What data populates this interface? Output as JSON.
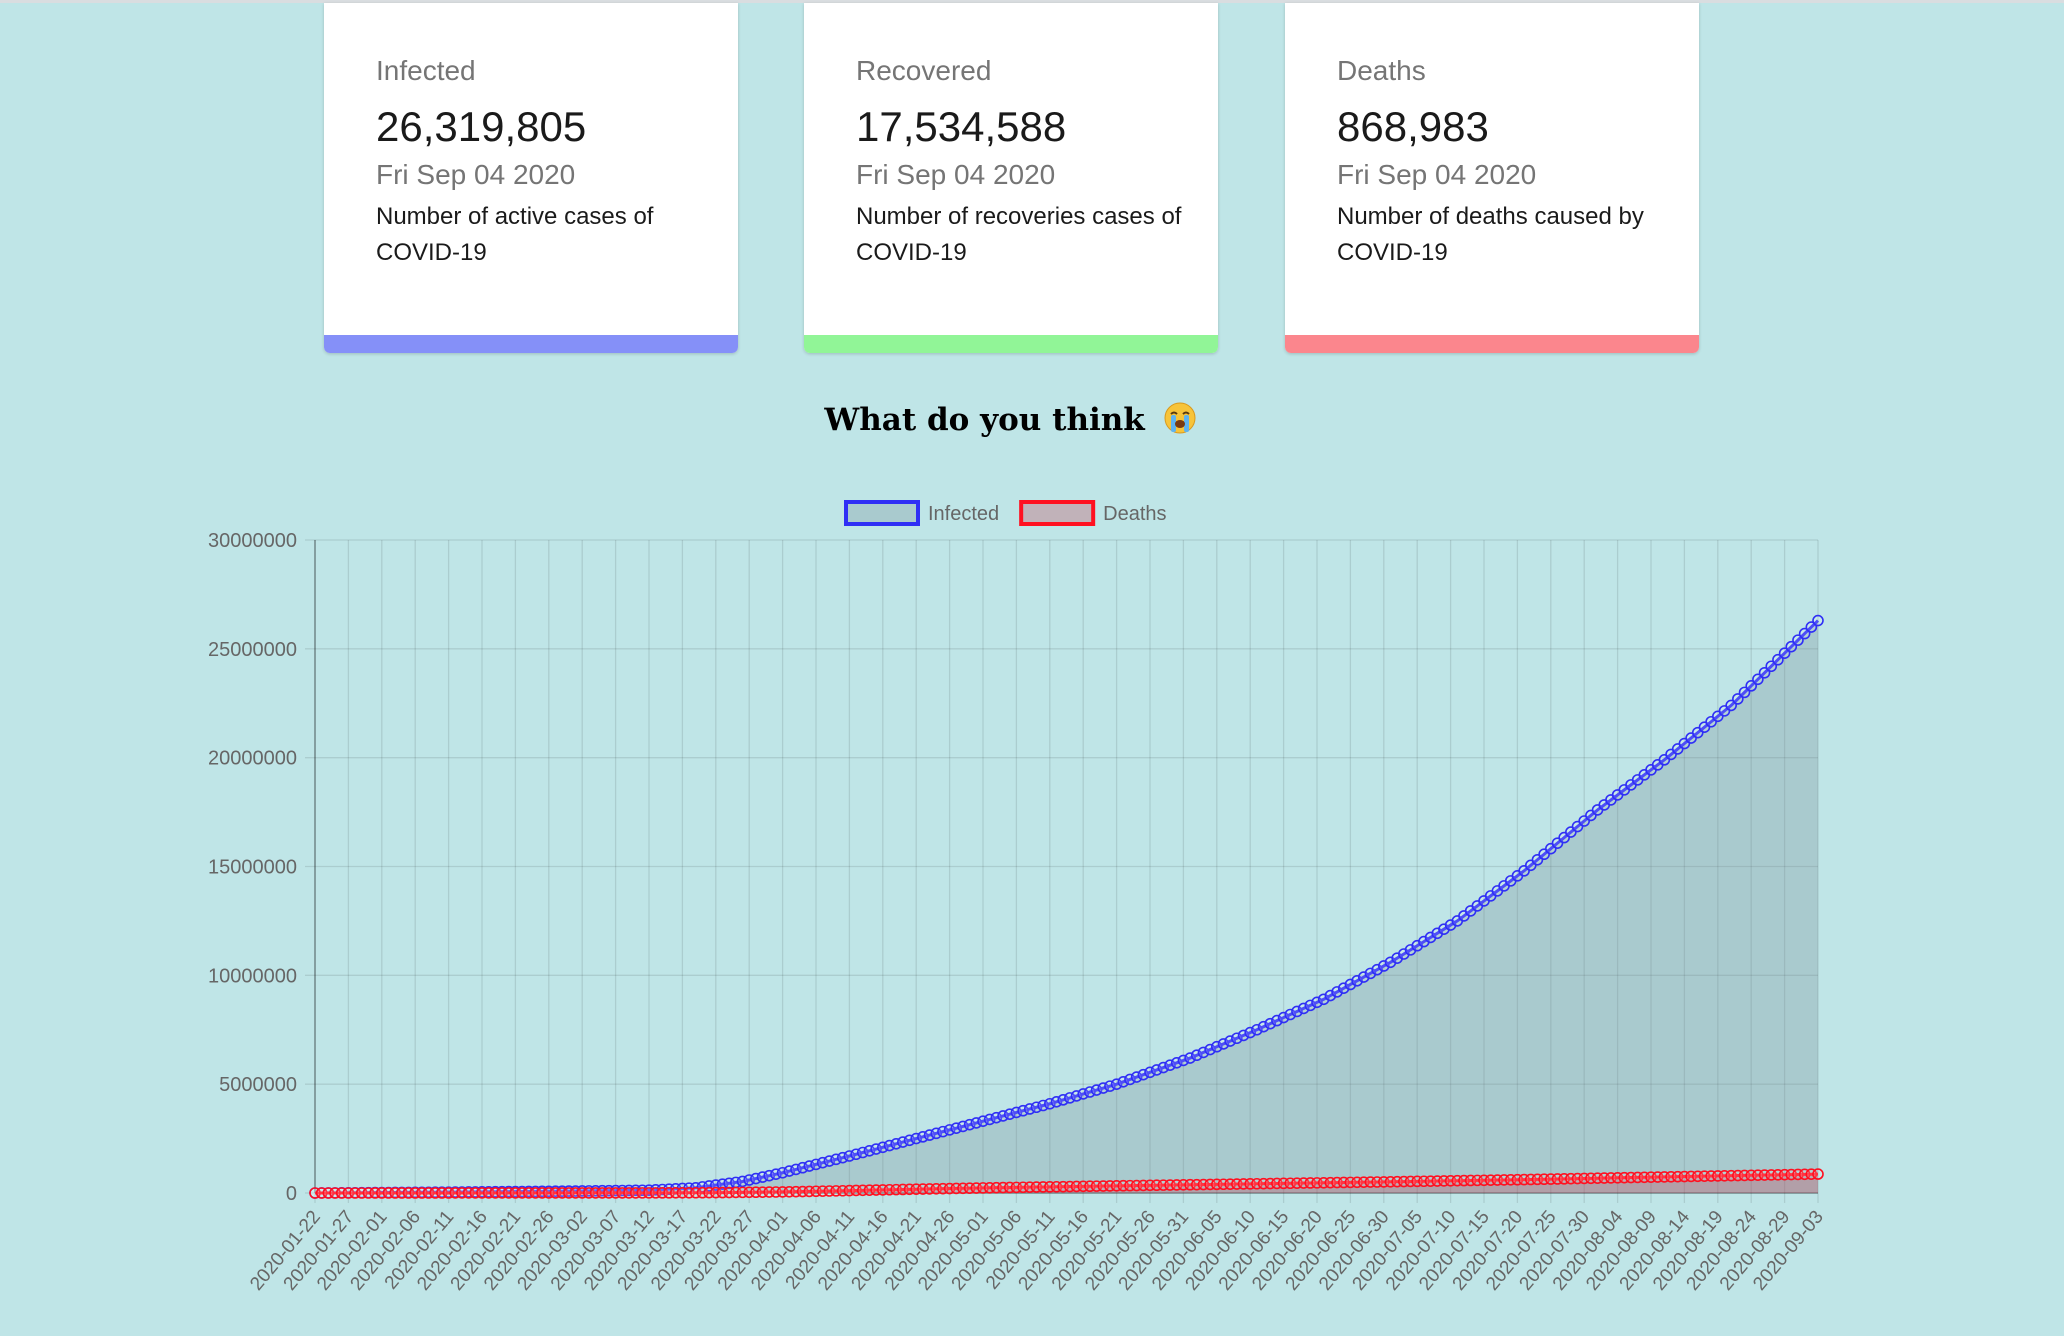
{
  "cards": [
    {
      "label": "Infected",
      "count": "26,319,805",
      "date": "Fri Sep 04 2020",
      "desc": "Number of active cases of COVID-19",
      "color": "#8590f8"
    },
    {
      "label": "Recovered",
      "count": "17,534,588",
      "date": "Fri Sep 04 2020",
      "desc": "Number of recoveries cases of COVID-19",
      "color": "#91f597"
    },
    {
      "label": "Deaths",
      "count": "868,983",
      "date": "Fri Sep 04 2020",
      "desc": "Number of deaths caused by COVID-19",
      "color": "#fb868d"
    }
  ],
  "heading": "What do you think",
  "heading_icon": "loudly-crying-face-icon",
  "chart_data": {
    "type": "area",
    "title": "",
    "xlabel": "",
    "ylabel": "",
    "ylim": [
      0,
      30000000
    ],
    "y_ticks": [
      0,
      5000000,
      10000000,
      15000000,
      20000000,
      25000000,
      30000000
    ],
    "x_range": [
      "2020-01-22",
      "2020-09-03"
    ],
    "x_tick_interval_days": 5,
    "grid": true,
    "legend": "top",
    "series": [
      {
        "name": "Infected",
        "color": "#2f2ff5",
        "fill": "rgba(120,140,150,0.30)",
        "points": [
          [
            "2020-01-22",
            0
          ],
          [
            "2020-02-11",
            40000
          ],
          [
            "2020-03-01",
            90000
          ],
          [
            "2020-03-12",
            130000
          ],
          [
            "2020-03-19",
            240000
          ],
          [
            "2020-03-26",
            530000
          ],
          [
            "2020-04-01",
            930000
          ],
          [
            "2020-04-11",
            1700000
          ],
          [
            "2020-04-21",
            2500000
          ],
          [
            "2020-05-01",
            3300000
          ],
          [
            "2020-05-11",
            4100000
          ],
          [
            "2020-05-21",
            5000000
          ],
          [
            "2020-06-01",
            6200000
          ],
          [
            "2020-06-11",
            7500000
          ],
          [
            "2020-06-21",
            8900000
          ],
          [
            "2020-07-01",
            10600000
          ],
          [
            "2020-07-11",
            12500000
          ],
          [
            "2020-07-21",
            14800000
          ],
          [
            "2020-08-01",
            17600000
          ],
          [
            "2020-08-11",
            19900000
          ],
          [
            "2020-08-21",
            22400000
          ],
          [
            "2020-09-03",
            26300000
          ]
        ]
      },
      {
        "name": "Deaths",
        "color": "#ff1020",
        "fill": "rgba(200,60,80,0.30)",
        "points": [
          [
            "2020-01-22",
            0
          ],
          [
            "2020-03-01",
            3000
          ],
          [
            "2020-03-15",
            6500
          ],
          [
            "2020-03-22",
            15000
          ],
          [
            "2020-04-01",
            50000
          ],
          [
            "2020-04-11",
            110000
          ],
          [
            "2020-04-21",
            175000
          ],
          [
            "2020-05-01",
            235000
          ],
          [
            "2020-05-21",
            330000
          ],
          [
            "2020-06-11",
            425000
          ],
          [
            "2020-07-01",
            515000
          ],
          [
            "2020-07-21",
            615000
          ],
          [
            "2020-08-11",
            740000
          ],
          [
            "2020-09-03",
            868983
          ]
        ]
      }
    ]
  }
}
